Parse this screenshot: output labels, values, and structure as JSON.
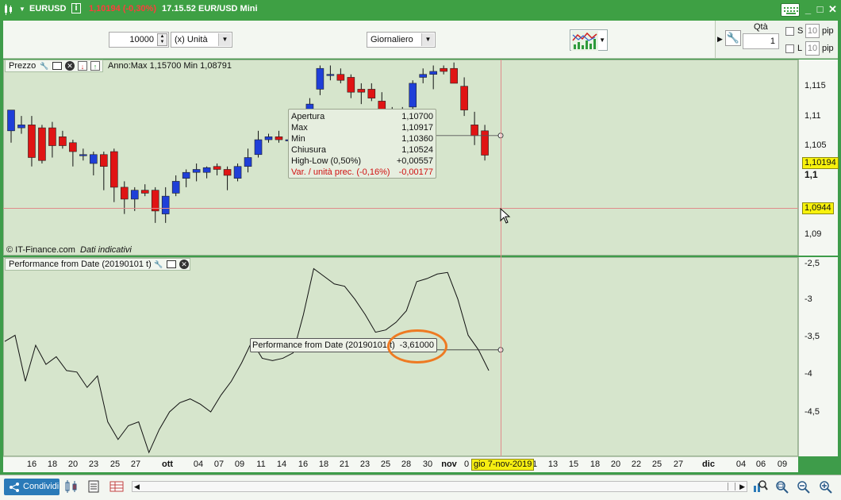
{
  "window": {
    "symbol": "EURUSD",
    "info_icon": "i",
    "price_change": "1,10194 (-0,30%)",
    "time": "17.15.52",
    "instrument_name": "EUR/USD Mini",
    "controls": {
      "keyboard": "keyboard-icon",
      "minimize": "_",
      "restore": "□",
      "close": "✕"
    }
  },
  "toolbar": {
    "quantity": "10000",
    "unit": "(x) Unità",
    "timeframe": "Giornaliero",
    "qty_label": "Qtà",
    "qty_value": "1",
    "stop_label": "S",
    "stop_pips": "10",
    "limit_label": "L",
    "limit_pips": "10",
    "pip_label": "pip"
  },
  "price_pane": {
    "title": "Prezzo",
    "year_info": "Anno:Max 1,15700 Min 1,08791",
    "copyright": "© IT-Finance.com",
    "disclaimer": "Dati indicativi",
    "y_labels": [
      "1,115",
      "1,11",
      "1,105",
      "1,1",
      "1,09"
    ],
    "last_price": "1,10194",
    "cursor_price": "1,0944",
    "colors": {
      "up": "#1f3fd8",
      "down": "#e01414",
      "bg": "#d6e5cc",
      "cursor": "#e88080"
    }
  },
  "tooltip": {
    "rows": [
      {
        "label": "Apertura",
        "value": "1,10700"
      },
      {
        "label": "Max",
        "value": "1,10917"
      },
      {
        "label": "Min",
        "value": "1,10360"
      },
      {
        "label": "Chiusura",
        "value": "1,10524"
      },
      {
        "label": "High-Low (0,50%)",
        "value": "+0,00557"
      },
      {
        "label": "Var. / unità prec. (-0,16%)",
        "value": "-0,00177"
      }
    ]
  },
  "perf_pane": {
    "title": "Performance from Date (20190101 t)",
    "callout_label": "Performance from Date (20190101 t)",
    "callout_value": "-3,61000",
    "y_labels": [
      "-2,5",
      "-3",
      "-3,5",
      "-4",
      "-4,5"
    ],
    "highlight_color": "#ee7a22"
  },
  "x_axis": {
    "labels": [
      "16",
      "18",
      "20",
      "23",
      "25",
      "27",
      "ott",
      "04",
      "07",
      "09",
      "11",
      "14",
      "16",
      "18",
      "21",
      "23",
      "25",
      "28",
      "30",
      "nov",
      "0",
      "1",
      "13",
      "15",
      "18",
      "20",
      "22",
      "25",
      "27",
      "dic",
      "04",
      "06",
      "09"
    ],
    "cursor_date": "gio 7-nov-2019"
  },
  "bottom": {
    "share_label": "Condividi"
  },
  "chart_data": [
    {
      "type": "candlestick",
      "y_labels": [
        "1,115",
        "1,11",
        "1,105",
        "1,1",
        "1,09"
      ],
      "ylim": [
        1.085,
        1.118
      ],
      "candles": [
        [
          1.106,
          1.1075,
          1.104,
          1.1095
        ],
        [
          1.1065,
          1.1085,
          1.1055,
          1.107
        ],
        [
          1.107,
          1.1085,
          1.1,
          1.1015
        ],
        [
          1.1065,
          1.107,
          1.1005,
          1.101
        ],
        [
          1.1065,
          1.1075,
          1.1015,
          1.1035
        ],
        [
          1.105,
          1.106,
          1.103,
          1.1035
        ],
        [
          1.104,
          1.1045,
          1.1,
          1.1025
        ],
        [
          1.102,
          1.103,
          1.101,
          1.102
        ],
        [
          1.1005,
          1.1025,
          1.0985,
          1.102
        ],
        [
          1.102,
          1.1025,
          1.096,
          1.1
        ],
        [
          1.1025,
          1.103,
          1.094,
          1.0965
        ],
        [
          1.0965,
          1.0975,
          1.092,
          1.0945
        ],
        [
          1.0945,
          1.0965,
          1.0925,
          1.096
        ],
        [
          1.096,
          1.097,
          1.095,
          1.0955
        ],
        [
          1.096,
          1.0965,
          1.0905,
          1.0925
        ],
        [
          1.092,
          1.0965,
          1.0905,
          1.095
        ],
        [
          1.0955,
          1.0985,
          1.095,
          1.0975
        ],
        [
          1.098,
          1.0995,
          1.0965,
          1.099
        ],
        [
          1.099,
          1.1005,
          1.0975,
          1.0995
        ],
        [
          1.099,
          1.1,
          1.098,
          1.0998
        ],
        [
          1.1,
          1.1005,
          1.0985,
          1.0995
        ],
        [
          1.0995,
          1.1,
          1.096,
          1.0985
        ],
        [
          1.098,
          1.1005,
          1.0975,
          1.1
        ],
        [
          1.1,
          1.103,
          1.099,
          1.1015
        ],
        [
          1.102,
          1.106,
          1.1015,
          1.1045
        ],
        [
          1.1045,
          1.1055,
          1.104,
          1.105
        ],
        [
          1.105,
          1.106,
          1.104,
          1.1045
        ],
        [
          1.1045,
          1.1065,
          1.103,
          1.1045
        ],
        [
          1.1045,
          1.1055,
          1.1035,
          1.105
        ],
        [
          1.107,
          1.1115,
          1.106,
          1.1105
        ],
        [
          1.113,
          1.117,
          1.112,
          1.1165
        ],
        [
          1.1155,
          1.117,
          1.1145,
          1.1155
        ],
        [
          1.1155,
          1.1165,
          1.114,
          1.1145
        ],
        [
          1.115,
          1.1155,
          1.1115,
          1.1125
        ],
        [
          1.113,
          1.114,
          1.1105,
          1.1125
        ],
        [
          1.113,
          1.114,
          1.111,
          1.1115
        ],
        [
          1.111,
          1.1125,
          1.109,
          1.109
        ],
        [
          1.1095,
          1.11,
          1.108,
          1.109
        ],
        [
          1.109,
          1.11,
          1.108,
          1.1095
        ],
        [
          1.11,
          1.1145,
          1.1095,
          1.114
        ],
        [
          1.115,
          1.1165,
          1.114,
          1.1155
        ],
        [
          1.1155,
          1.117,
          1.113,
          1.116
        ],
        [
          1.1165,
          1.117,
          1.1155,
          1.116
        ],
        [
          1.1165,
          1.1175,
          1.114,
          1.114
        ],
        [
          1.1135,
          1.115,
          1.1085,
          1.1095
        ],
        [
          1.107,
          1.1092,
          1.1036,
          1.1052
        ],
        [
          1.106,
          1.107,
          1.101,
          1.1019
        ]
      ]
    },
    {
      "type": "line",
      "y_labels": [
        "-2,5",
        "-3",
        "-3,5",
        "-4",
        "-4,5"
      ],
      "ylim": [
        -5.0,
        -2.4
      ],
      "series": [
        {
          "values": [
            -3.5,
            -3.42,
            -4.02,
            -3.55,
            -3.8,
            -3.7,
            -3.88,
            -3.9,
            -4.1,
            -3.95,
            -4.55,
            -4.78,
            -4.6,
            -4.55,
            -4.95,
            -4.65,
            -4.42,
            -4.3,
            -4.25,
            -4.32,
            -4.42,
            -4.2,
            -4.02,
            -3.78,
            -3.5,
            -3.72,
            -3.75,
            -3.72,
            -3.65,
            -3.15,
            -2.55,
            -2.65,
            -2.75,
            -2.78,
            -2.95,
            -3.15,
            -3.38,
            -3.35,
            -3.25,
            -3.1,
            -2.72,
            -2.68,
            -2.62,
            -2.6,
            -2.95,
            -3.42,
            -3.61,
            -3.88
          ]
        }
      ]
    }
  ]
}
